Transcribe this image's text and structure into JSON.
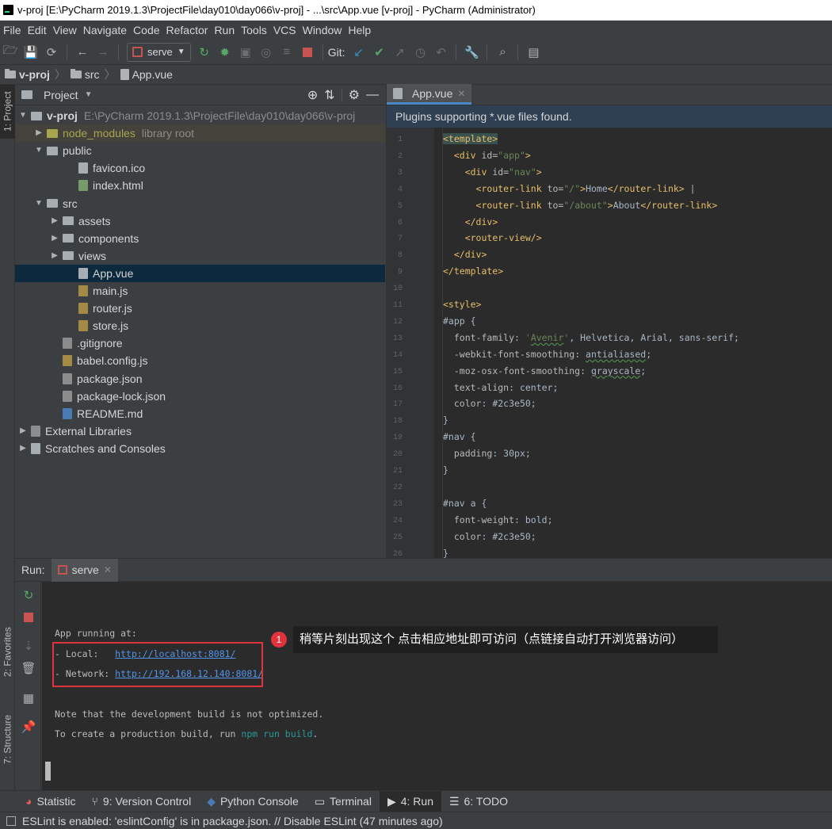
{
  "window": {
    "title": "v-proj [E:\\PyCharm 2019.1.3\\ProjectFile\\day010\\day066\\v-proj] - ...\\src\\App.vue [v-proj] - PyCharm (Administrator)"
  },
  "menu": [
    "File",
    "Edit",
    "View",
    "Navigate",
    "Code",
    "Refactor",
    "Run",
    "Tools",
    "VCS",
    "Window",
    "Help"
  ],
  "toolbar": {
    "run_config": "serve",
    "git_label": "Git:"
  },
  "breadcrumb": [
    "v-proj",
    "src",
    "App.vue"
  ],
  "project_panel": {
    "title": "Project",
    "side_tab": "1: Project",
    "tree": [
      {
        "label": "v-proj",
        "suffix": "E:\\PyCharm 2019.1.3\\ProjectFile\\day010\\day066\\v-proj",
        "kind": "root"
      },
      {
        "label": "node_modules",
        "suffix": "library root",
        "kind": "library"
      },
      {
        "label": "public",
        "kind": "folder"
      },
      {
        "label": "favicon.ico",
        "kind": "file"
      },
      {
        "label": "index.html",
        "kind": "file"
      },
      {
        "label": "src",
        "kind": "folder"
      },
      {
        "label": "assets",
        "kind": "folder"
      },
      {
        "label": "components",
        "kind": "folder"
      },
      {
        "label": "views",
        "kind": "folder"
      },
      {
        "label": "App.vue",
        "kind": "file",
        "selected": true
      },
      {
        "label": "main.js",
        "kind": "file"
      },
      {
        "label": "router.js",
        "kind": "file"
      },
      {
        "label": "store.js",
        "kind": "file"
      },
      {
        "label": ".gitignore",
        "kind": "file"
      },
      {
        "label": "babel.config.js",
        "kind": "file"
      },
      {
        "label": "package.json",
        "kind": "file"
      },
      {
        "label": "package-lock.json",
        "kind": "file"
      },
      {
        "label": "README.md",
        "kind": "file"
      },
      {
        "label": "External Libraries",
        "kind": "external"
      },
      {
        "label": "Scratches and Consoles",
        "kind": "external"
      }
    ]
  },
  "editor": {
    "tab": "App.vue",
    "banner": "Plugins supporting *.vue files found.",
    "line_numbers": [
      "1",
      "2",
      "3",
      "4",
      "5",
      "6",
      "7",
      "8",
      "9",
      "10",
      "11",
      "12",
      "13",
      "14",
      "15",
      "16",
      "17",
      "18",
      "19",
      "20",
      "21",
      "22",
      "23",
      "24",
      "25",
      "26"
    ]
  },
  "run_panel": {
    "label": "Run:",
    "tab": "serve",
    "console": {
      "line1": "App running at:",
      "local_prefix": "- Local:   ",
      "local_url": "http://localhost:8081/",
      "network_prefix": "- Network: ",
      "network_url": "http://192.168.12.140:8081/",
      "note": "Note that the development build is not optimized.",
      "build_prefix": "To create a production build, run ",
      "build_cmd": "npm run build",
      "build_suffix": "."
    },
    "side_tabs": [
      "2: Favorites",
      "7: Structure"
    ]
  },
  "annotation": {
    "badge": "1",
    "text": "稍等片刻出现这个 点击相应地址即可访问（点链接自动打开浏览器访问）"
  },
  "bottom_tabs": [
    "Statistic",
    "9: Version Control",
    "Python Console",
    "Terminal",
    "4: Run",
    "6: TODO"
  ],
  "status": "ESLint is enabled: 'eslintConfig' is in package.json. // Disable ESLint (47 minutes ago)"
}
